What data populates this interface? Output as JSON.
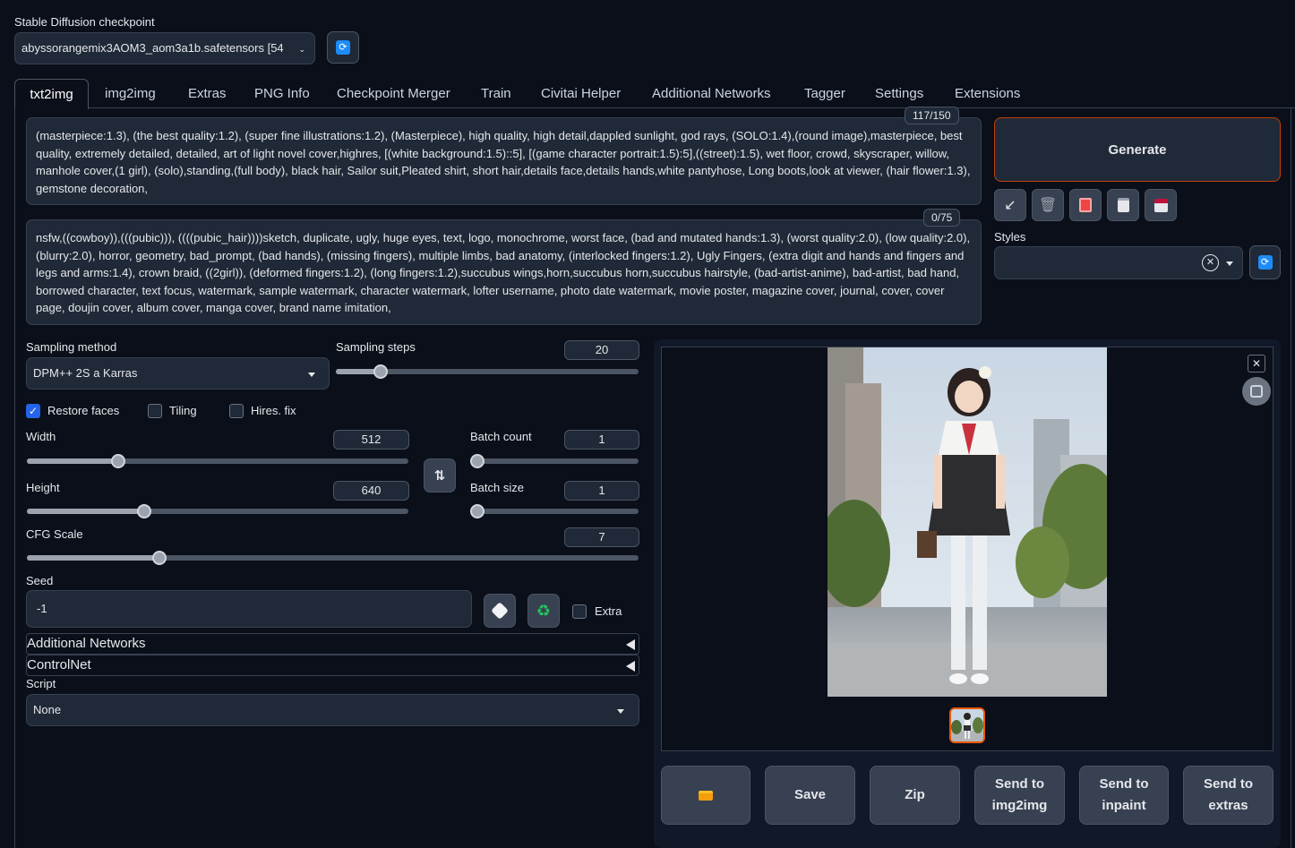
{
  "checkpoint": {
    "label": "Stable Diffusion checkpoint",
    "value": "abyssorangemix3AOM3_aom3a1b.safetensors [54"
  },
  "tabs": [
    "txt2img",
    "img2img",
    "Extras",
    "PNG Info",
    "Checkpoint Merger",
    "Train",
    "Civitai Helper",
    "Additional Networks",
    "Tagger",
    "Settings",
    "Extensions"
  ],
  "prompt": {
    "counter": "117/150",
    "text": "(masterpiece:1.3), (the best quality:1.2), (super fine illustrations:1.2), (Masterpiece), high quality, high detail,dappled sunlight, god rays, (SOLO:1.4),(round image),masterpiece, best quality, extremely detailed, detailed, art of light novel cover,highres, [(white background:1.5)::5], [(game character portrait:1.5):5],((street):1.5), wet floor, crowd, skyscraper, willow, manhole cover,(1 girl), (solo),standing,(full body), black hair, Sailor suit,Pleated shirt, short hair,details face,details hands,white pantyhose, Long boots,look at viewer, (hair flower:1.3), gemstone decoration,"
  },
  "negative_prompt": {
    "counter": "0/75",
    "text": "nsfw,((cowboy)),(((pubic))), ((((pubic_hair))))sketch, duplicate, ugly, huge eyes, text, logo, monochrome, worst face, (bad and mutated hands:1.3), (worst quality:2.0), (low quality:2.0), (blurry:2.0), horror, geometry, bad_prompt, (bad hands), (missing fingers), multiple limbs, bad anatomy, (interlocked fingers:1.2), Ugly Fingers, (extra digit and hands and fingers and legs and arms:1.4), crown braid, ((2girl)), (deformed fingers:1.2), (long fingers:1.2),succubus wings,horn,succubus horn,succubus hairstyle, (bad-artist-anime), bad-artist, bad hand, borrowed character, text focus, watermark, sample watermark, character watermark, lofter username, photo date watermark, movie poster, magazine cover, journal, cover, cover page, doujin cover, album cover, manga cover, brand name imitation,"
  },
  "generate_label": "Generate",
  "styles_label": "Styles",
  "sampling": {
    "method_label": "Sampling method",
    "method_value": "DPM++ 2S a Karras",
    "steps_label": "Sampling steps",
    "steps_value": "20",
    "steps_fraction": 0.13
  },
  "options": {
    "restore_faces": "Restore faces",
    "tiling": "Tiling",
    "hires_fix": "Hires. fix"
  },
  "width": {
    "label": "Width",
    "value": "512",
    "fraction": 0.23
  },
  "height": {
    "label": "Height",
    "value": "640",
    "fraction": 0.3
  },
  "batch_count": {
    "label": "Batch count",
    "value": "1",
    "fraction": 0.0
  },
  "batch_size": {
    "label": "Batch size",
    "value": "1",
    "fraction": 0.0
  },
  "cfg": {
    "label": "CFG Scale",
    "value": "7",
    "fraction": 0.21
  },
  "seed": {
    "label": "Seed",
    "value": "-1",
    "extra_label": "Extra"
  },
  "accordions": {
    "additional_networks": "Additional Networks",
    "controlnet": "ControlNet"
  },
  "script": {
    "label": "Script",
    "value": "None"
  },
  "output_buttons": {
    "save": "Save",
    "zip": "Zip",
    "send_img2img_1": "Send to",
    "send_img2img_2": "img2img",
    "send_inpaint_1": "Send to",
    "send_inpaint_2": "inpaint",
    "send_extras_1": "Send to",
    "send_extras_2": "extras"
  },
  "icons": {
    "refresh": "refresh-icon",
    "arrow": "arrow-icon",
    "trash": "trash-icon",
    "card": "card-icon",
    "clipboard": "clipboard-icon",
    "save": "save-icon",
    "swap": "swap-icon",
    "dice": "dice-icon",
    "recycle": "recycle-icon",
    "folder": "folder-icon"
  }
}
